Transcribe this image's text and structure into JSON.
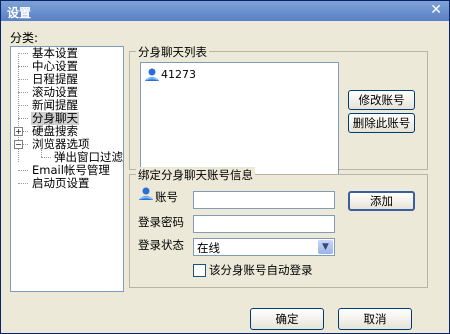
{
  "window": {
    "title": "设置",
    "close_glyph": "✕"
  },
  "category_label": "分类:",
  "tree": [
    {
      "label": "基本设置",
      "selected": false
    },
    {
      "label": "中心设置",
      "selected": false
    },
    {
      "label": "日程提醒",
      "selected": false
    },
    {
      "label": "滚动设置",
      "selected": false
    },
    {
      "label": "新闻提醒",
      "selected": false
    },
    {
      "label": "分身聊天",
      "selected": true
    },
    {
      "label": "硬盘搜索",
      "expander": "+"
    },
    {
      "label": "浏览器选项",
      "expander": "−"
    },
    {
      "label": "弹出窗口过滤"
    },
    {
      "label": "Email帐号管理"
    },
    {
      "label": "启动页设置"
    }
  ],
  "account_list": {
    "title": "分身聊天列表",
    "items": [
      {
        "name": "41273",
        "icon": "user-icon"
      }
    ],
    "modify_button": "修改账号",
    "delete_button": "删除此账号"
  },
  "bind_info": {
    "title": "绑定分身聊天账号信息",
    "account_label": "账号",
    "account_value": "",
    "add_button": "添加",
    "password_label": "登录密码",
    "password_value": "",
    "status_label": "登录状态",
    "status_value": "在线",
    "auto_login_label": "该分身账号自动登录",
    "auto_login_checked": false
  },
  "footer": {
    "ok_button": "确定",
    "cancel_button": "取消"
  },
  "colors": {
    "title_bar": "#6b8fd0",
    "dialog_bg": "#ece9d8",
    "field_border": "#7f9db9"
  }
}
